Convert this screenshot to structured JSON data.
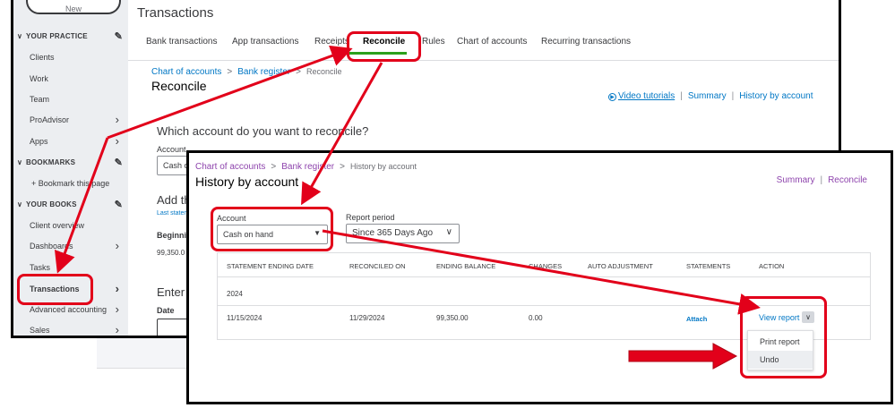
{
  "bg": {
    "sidebar": {
      "pill_label": "New",
      "sections": [
        {
          "label": "YOUR PRACTICE"
        },
        {
          "label": "BOOKMARKS"
        },
        {
          "label": "YOUR BOOKS"
        }
      ],
      "practice_items": [
        "Clients",
        "Work",
        "Team",
        "ProAdvisor",
        "Apps"
      ],
      "bookmark_item": "Bookmark this page",
      "books_items": [
        "Client overview",
        "Dashboards",
        "Tasks",
        "Transactions",
        "Advanced accounting",
        "Sales"
      ]
    },
    "page_title": "Transactions",
    "tabs": [
      "Bank transactions",
      "App transactions",
      "Receipts",
      "Reconcile",
      "Rules",
      "Chart of accounts",
      "Recurring transactions"
    ],
    "breadcrumb": {
      "a": "Chart of accounts",
      "b": "Bank register",
      "c": "Reconcile"
    },
    "heading": "Reconcile",
    "links": {
      "video": "Video tutorials",
      "summary": "Summary",
      "history": "History by account"
    },
    "question": "Which account do you want to reconcile?",
    "account_label": "Account",
    "account_value": "Cash on",
    "add_the": "Add th",
    "last_statement": "Last statem",
    "beginning": "Beginnin",
    "amount": "99,350.0",
    "enter_t": "Enter t",
    "date_label": "Date"
  },
  "fg": {
    "breadcrumb": {
      "a": "Chart of accounts",
      "b": "Bank register",
      "c": "History by account"
    },
    "title": "History by account",
    "links": {
      "summary": "Summary",
      "reconcile": "Reconcile"
    },
    "account_label": "Account",
    "account_value": "Cash on hand",
    "period_label": "Report period",
    "period_value": "Since 365 Days Ago",
    "table": {
      "headers": [
        "STATEMENT ENDING DATE",
        "RECONCILED ON",
        "ENDING BALANCE",
        "CHANGES",
        "AUTO ADJUSTMENT",
        "STATEMENTS",
        "ACTION"
      ],
      "group": "2024",
      "row": {
        "ending_date": "11/15/2024",
        "reconciled_on": "11/29/2024",
        "balance": "99,350.00",
        "changes": "0.00",
        "statements": "Attach",
        "action": "View report"
      }
    },
    "dropdown": [
      "Print report",
      "Undo"
    ]
  },
  "colors": {
    "annotation": "#e2001a",
    "link_blue": "#0077c5",
    "link_purple": "#8e44ad",
    "tab_active": "#2ca01c"
  }
}
